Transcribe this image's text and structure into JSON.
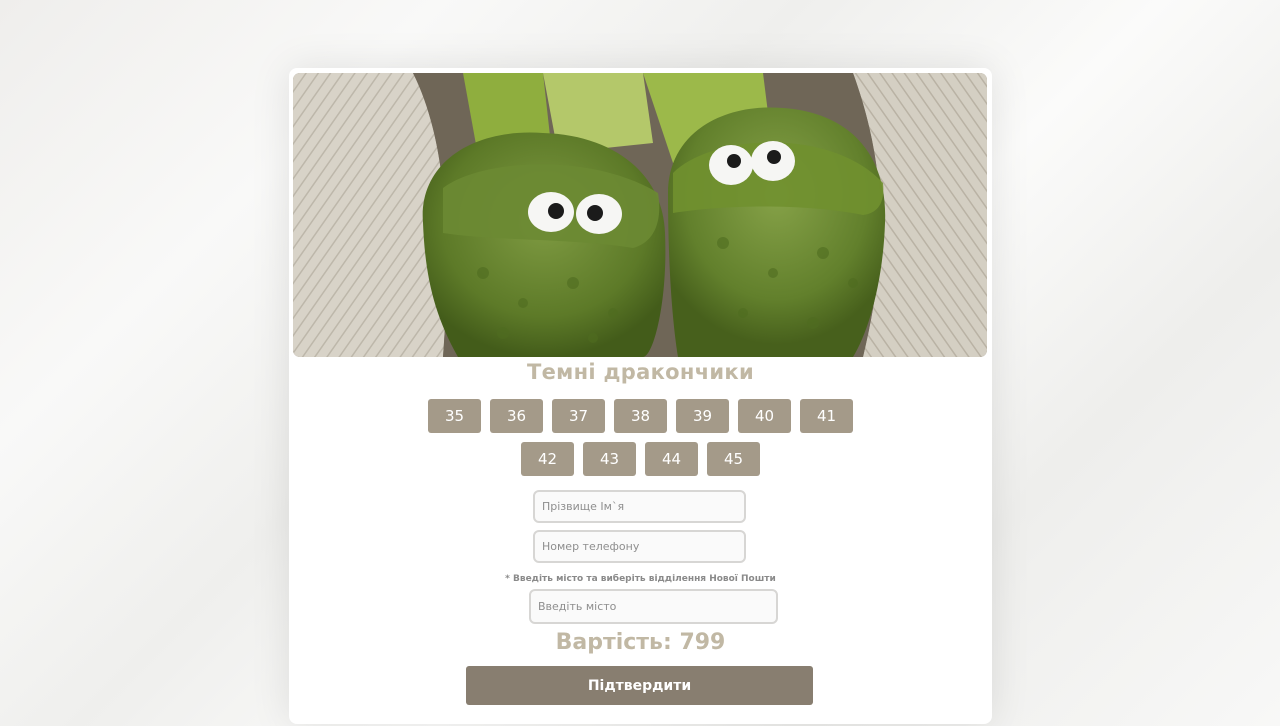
{
  "product": {
    "image_alt": "Green fluffy dragon slippers with googly eyes",
    "title": "Темні дракончики"
  },
  "sizes": {
    "row1": [
      "35",
      "36",
      "37",
      "38",
      "39",
      "40",
      "41"
    ],
    "row2": [
      "42",
      "43",
      "44",
      "45"
    ]
  },
  "form": {
    "name_placeholder": "Прізвище Ім`я",
    "phone_placeholder": "Номер телефону",
    "delivery_hint": "* Введіть місто та виберіть відділення Нової Пошти",
    "city_placeholder": "Введіть місто"
  },
  "price": {
    "label": "Вартість:",
    "value": "799"
  },
  "actions": {
    "confirm_label": "Підтвердити"
  },
  "colors": {
    "accent": "#a49a89",
    "button_dark": "#887e70",
    "title_text": "#c1b8a4"
  }
}
